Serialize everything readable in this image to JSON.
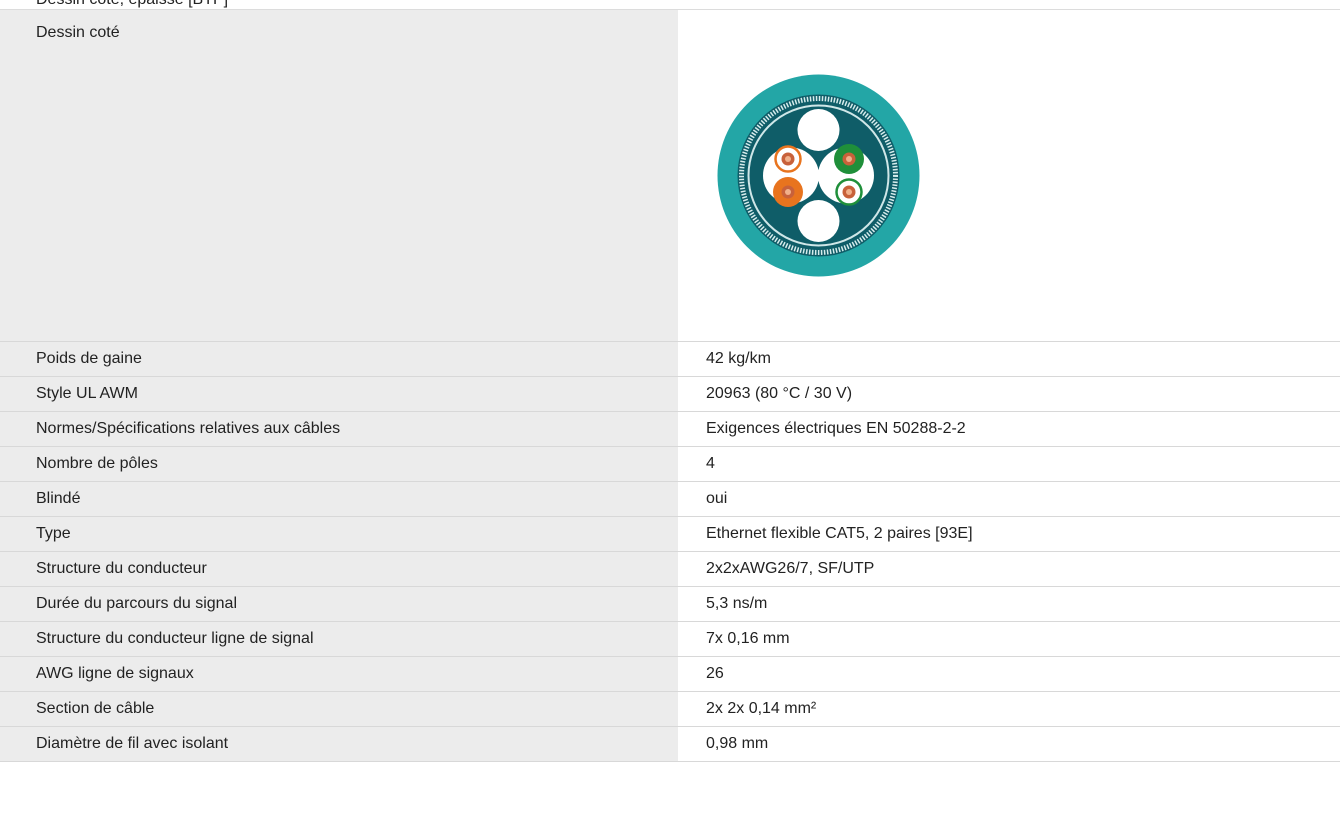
{
  "header": {
    "partial_text": "Dessin coté, épaisse [BTP]"
  },
  "drawing": {
    "label": "Dessin coté",
    "icon": "cable-cross-section-icon",
    "colors": {
      "jacket": "#23a6a6",
      "inner": "#0f5d68",
      "braid": "#cfe7e8",
      "orange": "#e8741e",
      "green": "#1f8f3a",
      "white": "#ffffff",
      "copper": "#c8613a"
    }
  },
  "specs": [
    {
      "label": "Poids de gaine",
      "value": "42 kg/km"
    },
    {
      "label": "Style UL AWM",
      "value": "20963 (80 °C / 30 V)"
    },
    {
      "label": "Normes/Spécifications relatives aux câbles",
      "value": "Exigences électriques EN 50288-2-2"
    },
    {
      "label": "Nombre de pôles",
      "value": "4"
    },
    {
      "label": "Blindé",
      "value": "oui"
    },
    {
      "label": "Type",
      "value": "Ethernet flexible CAT5, 2 paires [93E]"
    },
    {
      "label": "Structure du conducteur",
      "value": "2x2xAWG26/7, SF/UTP"
    },
    {
      "label": "Durée du parcours du signal",
      "value": "5,3 ns/m"
    },
    {
      "label": "Structure du conducteur ligne de signal",
      "value": "7x 0,16 mm"
    },
    {
      "label": "AWG ligne de signaux",
      "value": "26"
    },
    {
      "label": "Section de câble",
      "value": "2x 2x 0,14 mm²"
    },
    {
      "label": "Diamètre de fil avec isolant",
      "value": "0,98 mm"
    }
  ]
}
